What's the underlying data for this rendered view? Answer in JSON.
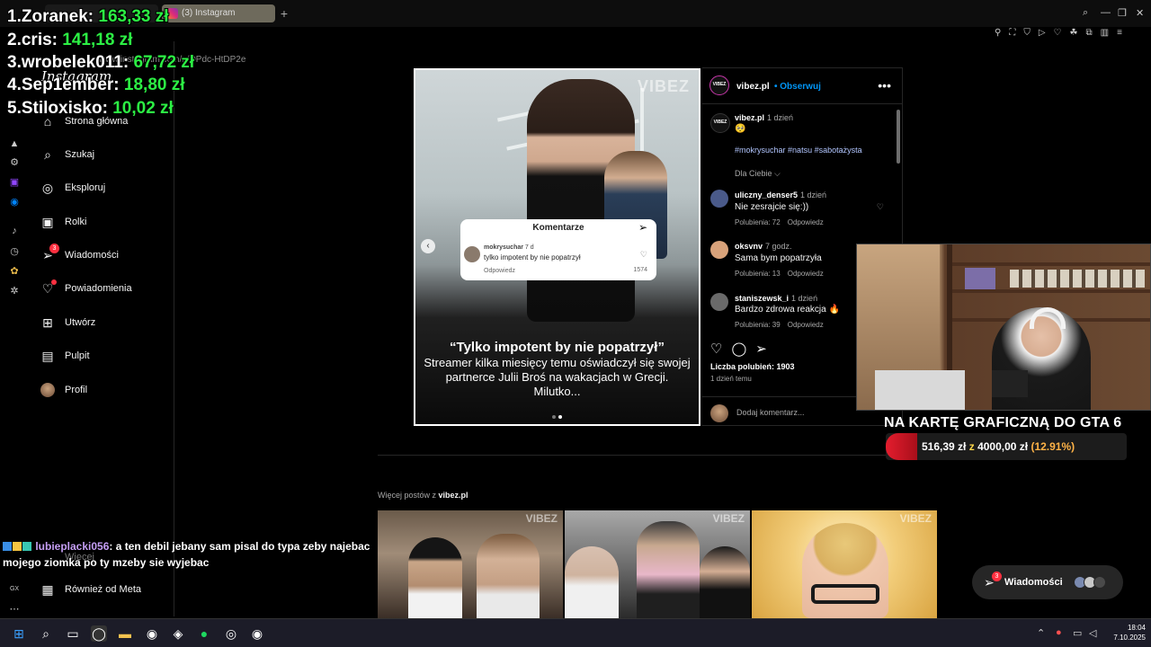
{
  "browser": {
    "tabs": [
      {
        "label": "(3) Instagram",
        "active": true
      }
    ],
    "url": "www.instagram.com/p/DPdc-HtDP2e",
    "new_tab": "+"
  },
  "instagram": {
    "logo": "Instagram",
    "nav": [
      {
        "label": "Strona główna",
        "icon": "home-icon"
      },
      {
        "label": "Szukaj",
        "icon": "search-icon"
      },
      {
        "label": "Eksploruj",
        "icon": "compass-icon"
      },
      {
        "label": "Rolki",
        "icon": "reels-icon"
      },
      {
        "label": "Wiadomości",
        "icon": "messenger-icon",
        "badge": "3"
      },
      {
        "label": "Powiadomienia",
        "icon": "heart-icon"
      },
      {
        "label": "Utwórz",
        "icon": "plus-icon"
      },
      {
        "label": "Pulpit",
        "icon": "dashboard-icon"
      },
      {
        "label": "Profil",
        "icon": "avatar"
      }
    ],
    "nav_more": "Więcej",
    "nav_meta": "Również od Meta",
    "post": {
      "watermark": "VIBEZ",
      "inner_comment": {
        "title": "Komentarze",
        "user": "mokrysuchar",
        "time": "7 d",
        "text": "tylko impotent by nie popatrzył",
        "reply": "Odpowiedz",
        "count": "1574"
      },
      "quote": "“Tylko impotent by nie popatrzył”",
      "body": "Streamer kilka miesięcy temu oświadczył się swojej partnerce Julii Broś na wakacjach w Grecji. Milutko..."
    },
    "side": {
      "account": "vibez.pl",
      "follow": "Obserwuj",
      "more": "•••",
      "avatar_text": "VIBEZ",
      "caption_user": "vibez.pl",
      "caption_time": "1 dzień",
      "caption_emoji": "🥺",
      "hashtags": [
        "#mokrysuchar",
        "#natsu",
        "#sabotażysta"
      ],
      "for_you": "Dla Ciebie ⌵",
      "comments": [
        {
          "user": "uliczny_denser5",
          "time": "1 dzień",
          "text": "Nie zesrajcie się:))",
          "likes": "Polubienia: 72",
          "reply": "Odpowiedz",
          "color": "#4a5a8a"
        },
        {
          "user": "oksvnv",
          "time": "7 godz.",
          "text": "Sama bym popatrzyła",
          "likes": "Polubienia: 13",
          "reply": "Odpowiedz",
          "color": "#d8a27a"
        },
        {
          "user": "staniszewsk_i",
          "time": "1 dzień",
          "text": "Bardzo zdrowa reakcja 🔥",
          "likes": "Polubienia: 39",
          "reply": "Odpowiedz",
          "color": "#6a6a6a"
        }
      ],
      "likes_count": "Liczba polubień: 1903",
      "ago": "1 dzień temu",
      "add_comment": "Dodaj komentarz..."
    },
    "more_posts_prefix": "Więcej postów z ",
    "more_posts_account": "vibez.pl",
    "thumb_watermark": "VIBEZ",
    "messages_pill": {
      "label": "Wiadomości",
      "badge": "3"
    }
  },
  "stream": {
    "donors": [
      {
        "rank": "1.",
        "name": "Zoranek:",
        "amount": "163,33 zł"
      },
      {
        "rank": "2.",
        "name": "cris:",
        "amount": "141,18 zł"
      },
      {
        "rank": "3.",
        "name": "wrobelek011:",
        "amount": "67,72 zł"
      },
      {
        "rank": "4.",
        "name": "Sep1ember:",
        "amount": "18,80 zł"
      },
      {
        "rank": "5.",
        "name": "Stiloxisko:",
        "amount": "10,02 zł"
      }
    ],
    "goal": {
      "title": "NA KARTĘ GRAFICZNĄ DO GTA 6",
      "current": "516,39 zł",
      "sep": "z",
      "target": "4000,00 zł",
      "percent": "(12.91%)",
      "fraction": 0.1291
    },
    "chat": {
      "user": "lubieplacki056",
      "message": ": a ten debil jebany sam pisal do typa zeby najebac mojego ziomka po ty mzeby sie wyjebac"
    }
  },
  "taskbar": {
    "time": "18:04",
    "date": "7.10.2025"
  },
  "colors": {
    "ig_blue": "#0095f6",
    "badge_red": "#ff3040",
    "donor_green": "#2cf044",
    "goal_red": "#e41d2e"
  }
}
